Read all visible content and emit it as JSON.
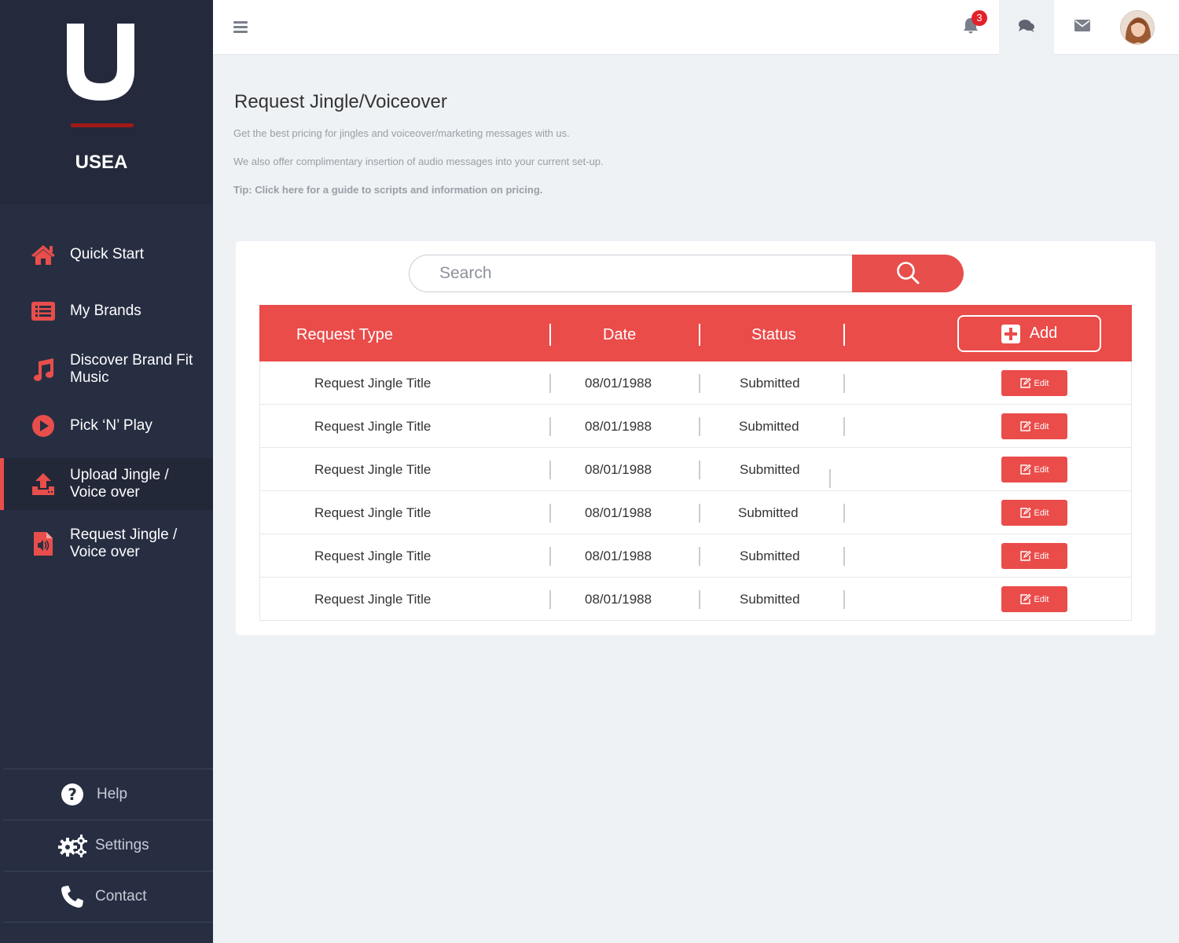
{
  "brand": {
    "logo_letter": "U",
    "name": "USEA"
  },
  "sidebar": {
    "items": [
      {
        "label": "Quick Start",
        "icon": "home-icon"
      },
      {
        "label": "My Brands",
        "icon": "list-icon"
      },
      {
        "label": "Discover Brand Fit Music",
        "icon": "music-note-icon"
      },
      {
        "label": "Pick ‘N’ Play",
        "icon": "play-circle-icon"
      },
      {
        "label": "Upload Jingle / Voice over",
        "icon": "upload-icon",
        "active": true
      },
      {
        "label": "Request Jingle / Voice over",
        "icon": "audio-file-icon"
      }
    ],
    "footer": [
      {
        "label": "Help",
        "icon": "question-icon"
      },
      {
        "label": "Settings",
        "icon": "gears-icon"
      },
      {
        "label": "Contact",
        "icon": "phone-icon"
      }
    ]
  },
  "topbar": {
    "notification_count": "3"
  },
  "colors": {
    "accent": "#ea4c4a",
    "sidebar_bg": "#272e42",
    "page_bg": "#eef2f5"
  },
  "page": {
    "title": "Request Jingle/Voiceover",
    "desc1": "Get the best pricing for jingles and voiceover/marketing messages with us.",
    "desc2": "We also offer complimentary insertion of audio messages into your current set-up.",
    "tip": "Tip: Click here for a guide to scripts and information on pricing."
  },
  "search": {
    "placeholder": "Search"
  },
  "table": {
    "headers": {
      "type": "Request Type",
      "date": "Date",
      "status": "Status",
      "add": "Add"
    },
    "edit_label": "Edit",
    "rows": [
      {
        "type": "Request Jingle Title",
        "date": "08/01/1988",
        "status": "Submitted"
      },
      {
        "type": "Request Jingle Title",
        "date": "08/01/1988",
        "status": "Submitted"
      },
      {
        "type": "Request Jingle Title",
        "date": "08/01/1988",
        "status": "Submitted"
      },
      {
        "type": "Request Jingle Title",
        "date": "08/01/1988",
        "status": "Submitted"
      },
      {
        "type": "Request Jingle Title",
        "date": "08/01/1988",
        "status": "Submitted"
      },
      {
        "type": "Request Jingle Title",
        "date": "08/01/1988",
        "status": "Submitted"
      }
    ]
  }
}
